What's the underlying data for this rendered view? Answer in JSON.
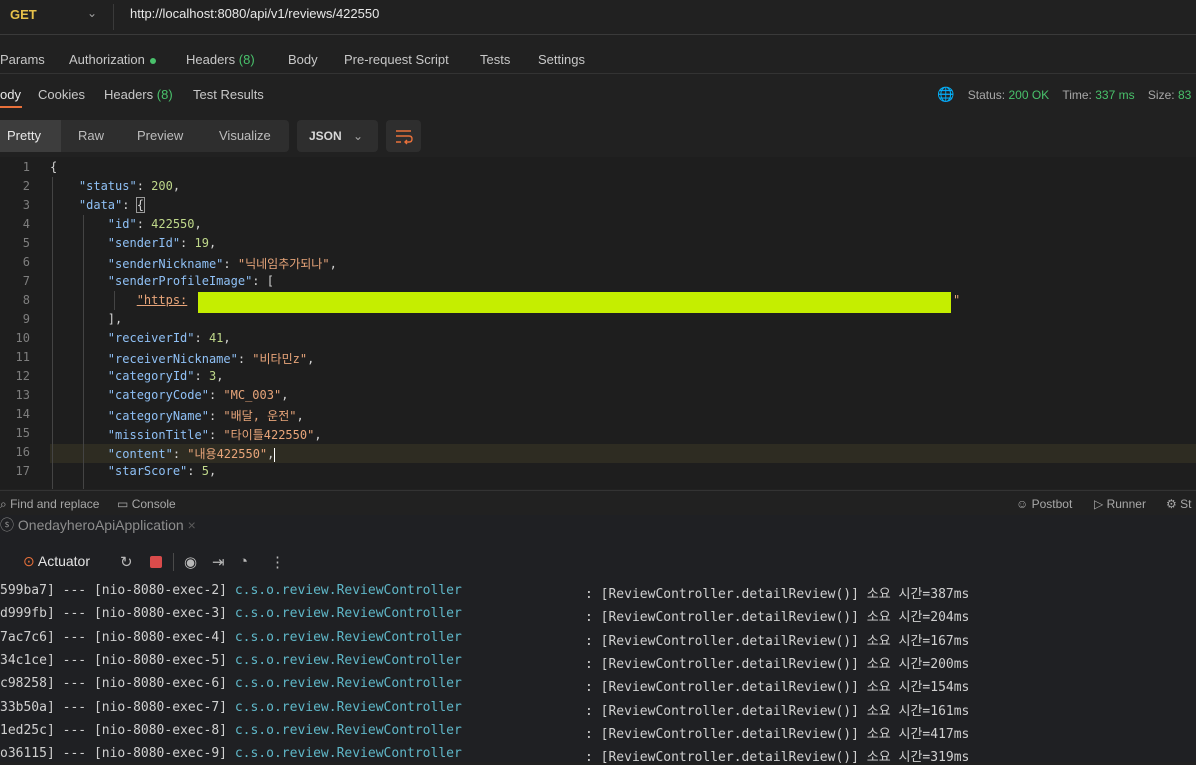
{
  "request": {
    "method": "GET",
    "url": "http://localhost:8080/api/v1/reviews/422550"
  },
  "request_tabs": {
    "params": "Params",
    "authorization": "Authorization",
    "headers": "Headers",
    "headers_count": "(8)",
    "body": "Body",
    "pre_request": "Pre-request Script",
    "tests": "Tests",
    "settings": "Settings"
  },
  "response_tabs": {
    "body": "ody",
    "cookies": "Cookies",
    "headers": "Headers",
    "headers_count": "(8)",
    "test_results": "Test Results"
  },
  "response_status": {
    "status_label": "Status:",
    "status_value": "200 OK",
    "time_label": "Time:",
    "time_value": "337 ms",
    "size_label": "Size:",
    "size_value": "83"
  },
  "view": {
    "pretty": "Pretty",
    "raw": "Raw",
    "preview": "Preview",
    "visualize": "Visualize",
    "format": "JSON"
  },
  "code": {
    "line_numbers": [
      "1",
      "2",
      "3",
      "4",
      "5",
      "6",
      "7",
      "8",
      "9",
      "10",
      "11",
      "12",
      "13",
      "14",
      "15",
      "16",
      "17"
    ],
    "status_key": "\"status\"",
    "status_val": "200",
    "data_key": "\"data\"",
    "id_key": "\"id\"",
    "id_val": "422550",
    "sender_id_key": "\"senderId\"",
    "sender_id_val": "19",
    "sender_nick_key": "\"senderNickname\"",
    "sender_nick_val": "\"닉네임추가되나\"",
    "sender_img_key": "\"senderProfileImage\"",
    "img_url_start": "\"https:",
    "img_url_end": "\"",
    "receiver_id_key": "\"receiverId\"",
    "receiver_id_val": "41",
    "receiver_nick_key": "\"receiverNickname\"",
    "receiver_nick_val": "\"비타민z\"",
    "category_id_key": "\"categoryId\"",
    "category_id_val": "3",
    "category_code_key": "\"categoryCode\"",
    "category_code_val": "\"MC_003\"",
    "category_name_key": "\"categoryName\"",
    "category_name_val": "\"배달, 운전\"",
    "mission_title_key": "\"missionTitle\"",
    "mission_title_val": "\"타이틀422550\"",
    "content_key": "\"content\"",
    "content_val": "\"내용422550\"",
    "star_key": "\"starScore\"",
    "star_val": "5"
  },
  "footer": {
    "find_replace": "Find and replace",
    "console": "Console",
    "postbot": "Postbot",
    "runner": "Runner",
    "more": "St"
  },
  "ide": {
    "app_tab": "OnedayheroApiApplication",
    "actuator": "Actuator",
    "logs": [
      {
        "id": "599ba7]",
        "thread": "[nio-8080-exec-2]",
        "cls": "c.s.o.review.ReviewController",
        "msg": ": [ReviewController.detailReview()] 소요 시간=387ms"
      },
      {
        "id": "d999fb]",
        "thread": "[nio-8080-exec-3]",
        "cls": "c.s.o.review.ReviewController",
        "msg": ": [ReviewController.detailReview()] 소요 시간=204ms"
      },
      {
        "id": "7ac7c6]",
        "thread": "[nio-8080-exec-4]",
        "cls": "c.s.o.review.ReviewController",
        "msg": ": [ReviewController.detailReview()] 소요 시간=167ms"
      },
      {
        "id": "34c1ce]",
        "thread": "[nio-8080-exec-5]",
        "cls": "c.s.o.review.ReviewController",
        "msg": ": [ReviewController.detailReview()] 소요 시간=200ms"
      },
      {
        "id": "c98258]",
        "thread": "[nio-8080-exec-6]",
        "cls": "c.s.o.review.ReviewController",
        "msg": ": [ReviewController.detailReview()] 소요 시간=154ms"
      },
      {
        "id": "33b50a]",
        "thread": "[nio-8080-exec-7]",
        "cls": "c.s.o.review.ReviewController",
        "msg": ": [ReviewController.detailReview()] 소요 시간=161ms"
      },
      {
        "id": "1ed25c]",
        "thread": "[nio-8080-exec-8]",
        "cls": "c.s.o.review.ReviewController",
        "msg": ": [ReviewController.detailReview()] 소요 시간=417ms"
      },
      {
        "id": "o36115]",
        "thread": "[nio-8080-exec-9]",
        "cls": "c.s.o.review.ReviewController",
        "msg": ": [ReviewController.detailReview()] 소요 시간=319ms"
      }
    ]
  }
}
